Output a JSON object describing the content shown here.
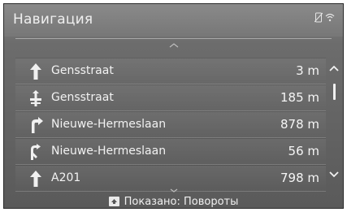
{
  "header": {
    "title": "Навигация",
    "status_icons": [
      "phone-off-icon",
      "wifi-icon"
    ]
  },
  "list": [
    {
      "icon": "arrow-straight-icon",
      "street": "Gensstraat",
      "distance": "3 m"
    },
    {
      "icon": "crossroad-icon",
      "street": "Gensstraat",
      "distance": "185 m"
    },
    {
      "icon": "turn-right-icon",
      "street": "Nieuwe-Hermeslaan",
      "distance": "878 m"
    },
    {
      "icon": "keep-right-icon",
      "street": "Nieuwe-Hermeslaan",
      "distance": "56 m"
    },
    {
      "icon": "arrow-straight-icon",
      "street": "A201",
      "distance": "798 m"
    }
  ],
  "footer": {
    "label": "Показано: Повороты"
  }
}
